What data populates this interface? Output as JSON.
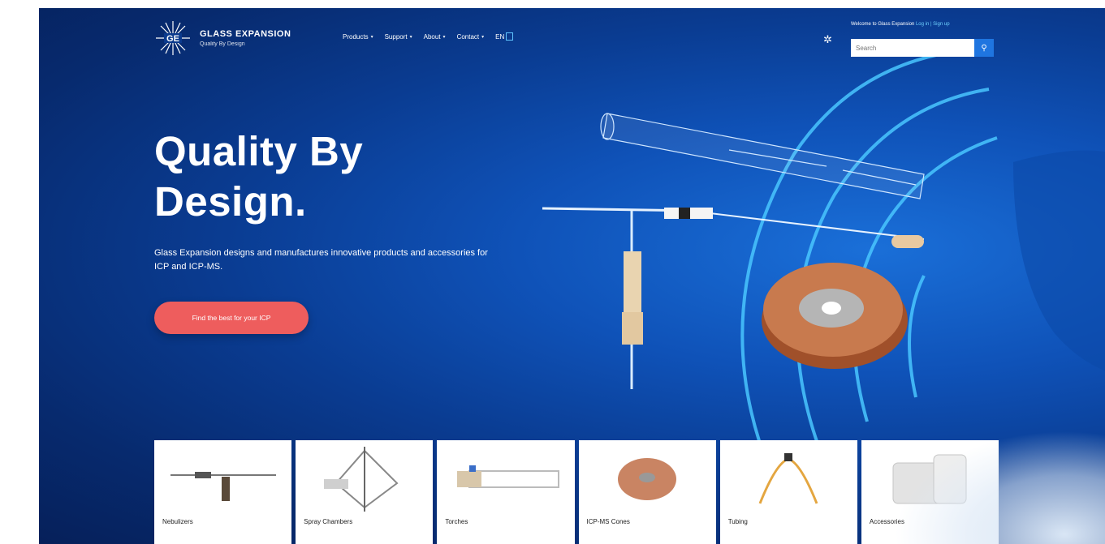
{
  "brand": {
    "name": "GLASS EXPANSION",
    "tagline": "Quality By Design"
  },
  "nav": {
    "items": [
      {
        "label": "Products"
      },
      {
        "label": "Support"
      },
      {
        "label": "About"
      },
      {
        "label": "Contact"
      }
    ],
    "lang": "EN"
  },
  "header": {
    "account_text": "Welcome to Glass Expansion",
    "account_link": "Log in | Sign up",
    "search_placeholder": "Search"
  },
  "hero": {
    "title": "Quality By Design.",
    "description": "Glass Expansion designs and manufactures innovative products and accessories for ICP and ICP-MS.",
    "cta": "Find the best for your ICP"
  },
  "products": [
    {
      "label": "Nebulizers"
    },
    {
      "label": "Spray Chambers"
    },
    {
      "label": "Torches"
    },
    {
      "label": "ICP-MS Cones"
    },
    {
      "label": "Tubing"
    },
    {
      "label": "Accessories"
    }
  ],
  "colors": {
    "accent": "#ee5d5d",
    "brand_blue": "#1f75e0",
    "link": "#6fd2ff"
  }
}
